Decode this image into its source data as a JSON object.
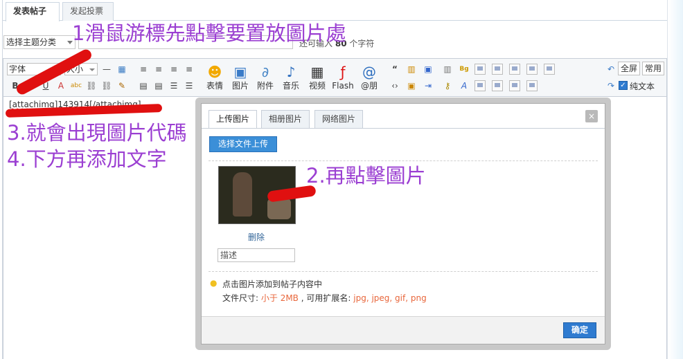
{
  "tabs": [
    "发表帖子",
    "发起投票"
  ],
  "topic_select": "选择主题分类",
  "title_hint": {
    "prefix": "还可输入",
    "count": "80",
    "suffix": "个字符"
  },
  "toolbar": {
    "font_select": "字体",
    "size_select": "大小",
    "big_buttons": [
      {
        "label": "表情",
        "icon": "smiley-icon"
      },
      {
        "label": "图片",
        "icon": "image-icon"
      },
      {
        "label": "附件",
        "icon": "paperclip-icon"
      },
      {
        "label": "音乐",
        "icon": "music-note-icon"
      },
      {
        "label": "视频",
        "icon": "video-film-icon"
      },
      {
        "label": "Flash",
        "icon": "flash-icon"
      },
      {
        "label": "@朋",
        "icon": "at-icon"
      }
    ],
    "fullscreen": "全屏",
    "common": "常用",
    "plaintext": "纯文本"
  },
  "editor": {
    "content": {
      "open": "[attachimg]",
      "id": "143914",
      "close": "[/attachimg]"
    }
  },
  "dialog": {
    "tabs": [
      "上传图片",
      "相册图片",
      "网络图片"
    ],
    "close": "×",
    "upload_button": "选择文件上传",
    "delete_link": "删除",
    "desc_placeholder": "描述",
    "tip_click": "点击图片添加到帖子内容中",
    "tip_size_label": "文件尺寸:",
    "tip_size_value": "小于 2MB",
    "tip_ext_label": ", 可用扩展名:",
    "tip_ext_value": "jpg, jpeg, gif, png",
    "ok_button": "确定"
  },
  "annotations": {
    "step1": "1滑鼠游標先點擊要置放圖片處",
    "step2": "2.再點擊圖片",
    "step3": "3.就會出現圖片代碼",
    "step4": "4.下方再添加文字"
  },
  "colors": {
    "annotation": "#9b3fd2",
    "marker": "#e01010",
    "accent_button": "#2f7bd0"
  }
}
